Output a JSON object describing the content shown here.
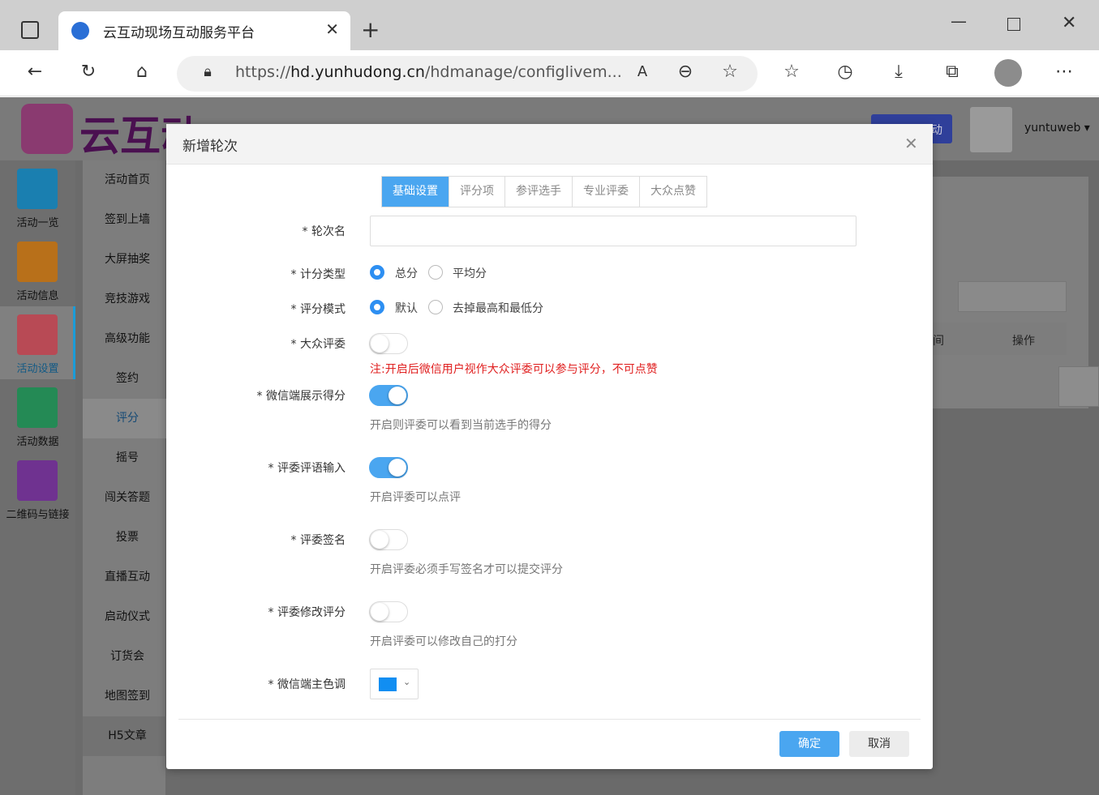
{
  "browser": {
    "tab_title": "云互动现场互动服务平台",
    "url_prefix": "https://",
    "url_host": "hd.yunhudong.cn",
    "url_path": "/hdmanage/configlivem..."
  },
  "site": {
    "logo_text": "云互动",
    "user_name": "yuntuweb",
    "top_button": "动"
  },
  "left_nav": [
    {
      "label": "活动一览",
      "color": "#1a9cd8"
    },
    {
      "label": "活动信息",
      "color": "#e48a1c"
    },
    {
      "label": "活动设置",
      "color": "#e6505a"
    },
    {
      "label": "活动数据",
      "color": "#2bb56d"
    },
    {
      "label": "二维码与链接",
      "color": "#8c3fb8"
    }
  ],
  "sub_nav": [
    "活动首页",
    "签到上墙",
    "大屏抽奖",
    "竞技游戏",
    "高级功能",
    "签约",
    "评分",
    "摇号",
    "闯关答题",
    "投票",
    "直播互动",
    "启动仪式",
    "订货会",
    "地图签到",
    "H5文章"
  ],
  "content": {
    "col_time": "间",
    "col_action": "操作"
  },
  "modal": {
    "title": "新增轮次",
    "tabs": [
      "基础设置",
      "评分项",
      "参评选手",
      "专业评委",
      "大众点赞"
    ],
    "fields": {
      "round_name": "轮次名",
      "score_type": "计分类型",
      "score_type_opt1": "总分",
      "score_type_opt2": "平均分",
      "score_mode": "评分模式",
      "score_mode_opt1": "默认",
      "score_mode_opt2": "去掉最高和最低分",
      "public_judge": "大众评委",
      "public_judge_note": "注:开启后微信用户视作大众评委可以参与评分，不可点赞",
      "wx_show_score": "微信端展示得分",
      "wx_show_score_hint": "开启则评委可以看到当前选手的得分",
      "judge_comment": "评委评语输入",
      "judge_comment_hint": "开启评委可以点评",
      "judge_sign": "评委签名",
      "judge_sign_hint": "开启评委必须手写签名才可以提交评分",
      "judge_modify": "评委修改评分",
      "judge_modify_hint": "开启评委可以修改自己的打分",
      "wx_theme": "微信端主色调"
    },
    "theme_color": "#118ef2",
    "ok": "确定",
    "cancel": "取消"
  }
}
